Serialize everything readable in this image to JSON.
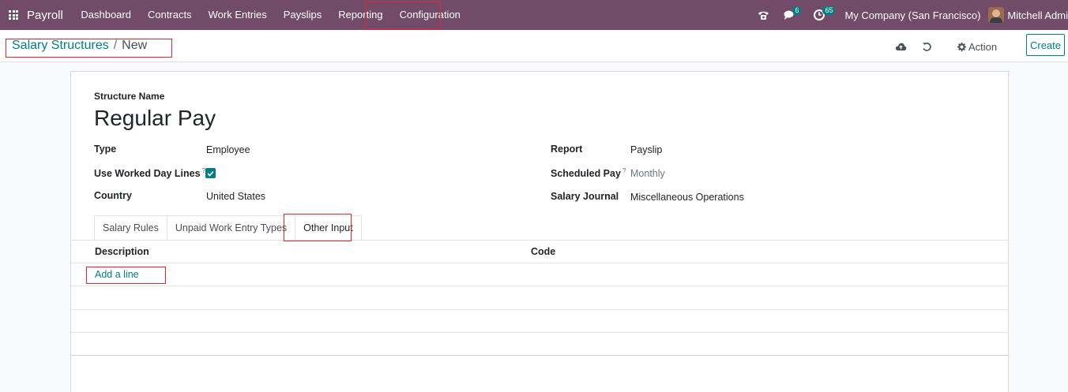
{
  "navbar": {
    "app_name": "Payroll",
    "menu": [
      "Dashboard",
      "Contracts",
      "Work Entries",
      "Payslips",
      "Reporting",
      "Configuration"
    ],
    "messages_count": "6",
    "activities_count": "65",
    "company": "My Company (San Francisco)",
    "user": "Mitchell Admi"
  },
  "breadcrumb": {
    "parent": "Salary Structures",
    "separator": "/",
    "current": "New"
  },
  "control_panel": {
    "action_label": "Action",
    "create_label": "Create"
  },
  "form": {
    "structure_name_label": "Structure Name",
    "structure_name": "Regular Pay",
    "type_label": "Type",
    "type_value": "Employee",
    "use_worked_day_lines_label": "Use Worked Day Lines",
    "use_worked_day_lines_checked": true,
    "country_label": "Country",
    "country_value": "United States",
    "report_label": "Report",
    "report_value": "Payslip",
    "scheduled_pay_label": "Scheduled Pay",
    "scheduled_pay_value": "Monthly",
    "salary_journal_label": "Salary Journal",
    "salary_journal_value": "Miscellaneous Operations",
    "help_marker": "?"
  },
  "tabs": [
    "Salary Rules",
    "Unpaid Work Entry Types",
    "Other Input"
  ],
  "active_tab": "Other Input",
  "table": {
    "columns": [
      "Description",
      "Code"
    ],
    "add_line_label": "Add a line"
  },
  "colors": {
    "navbar": "#714b67",
    "accent": "#017e84",
    "highlight": "#e0262e"
  }
}
